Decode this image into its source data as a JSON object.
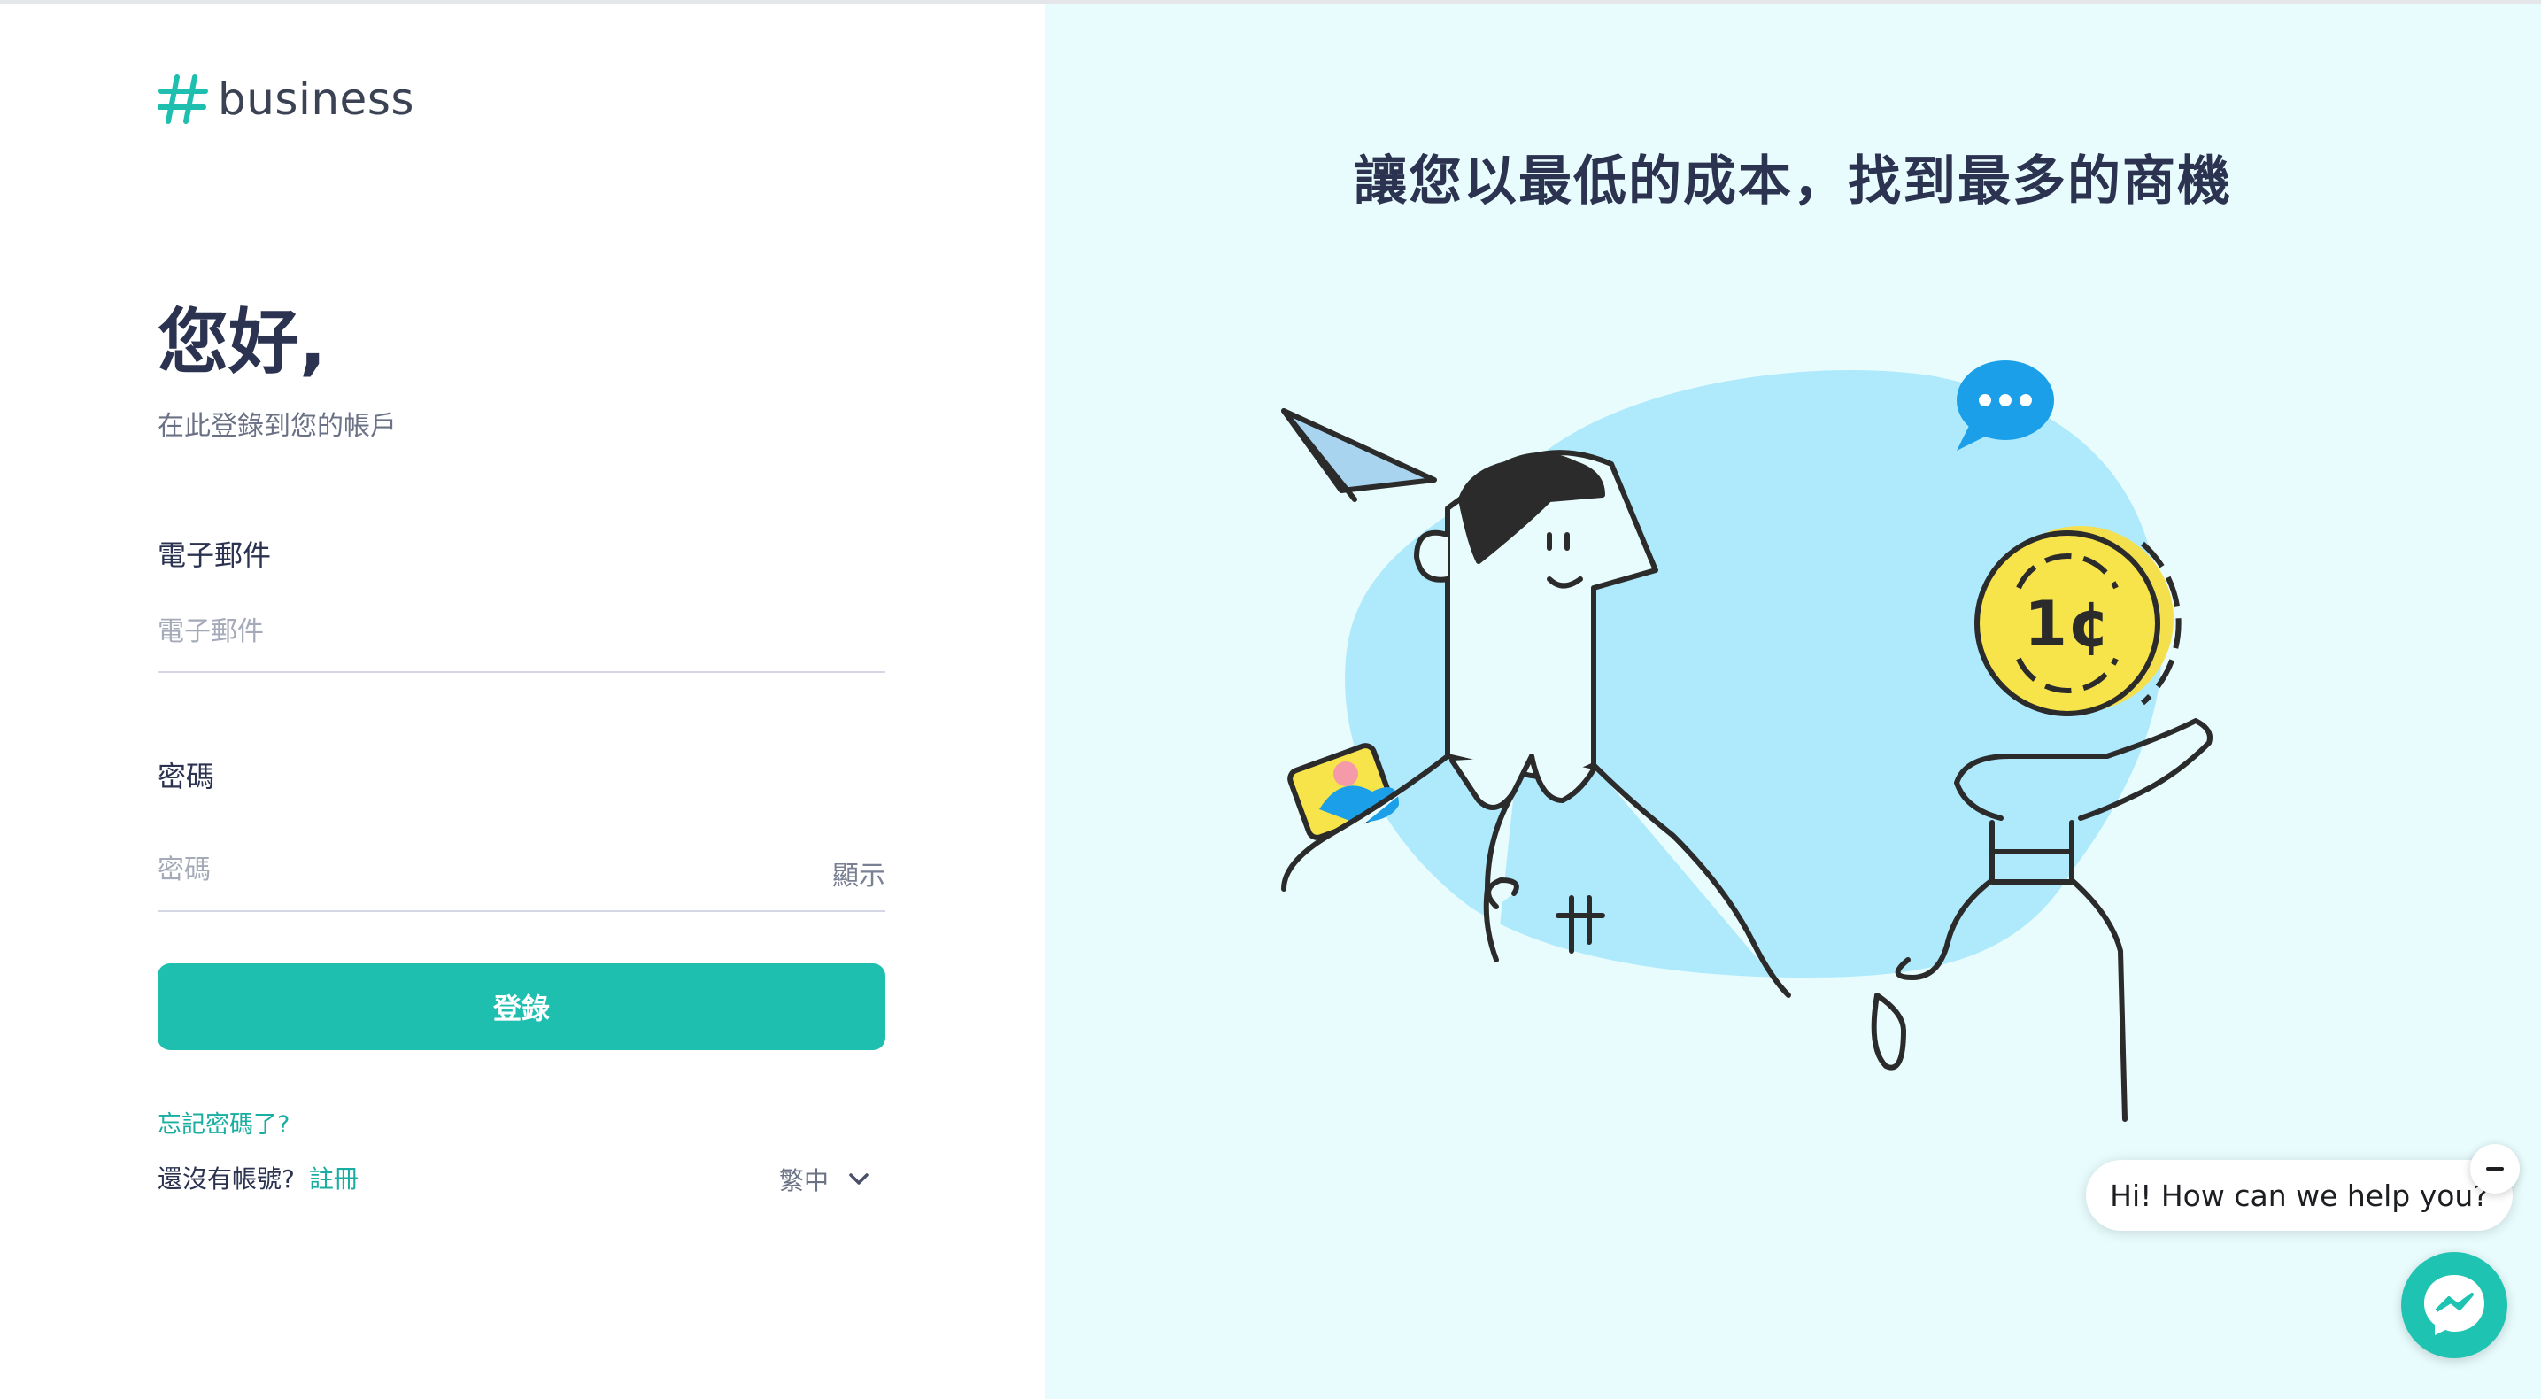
{
  "brand": {
    "logo_text": "business",
    "logo_icon": "hash-icon",
    "accent_color": "#1fbfb0"
  },
  "login": {
    "greeting": "您好,",
    "subtitle": "在此登錄到您的帳戶",
    "email_label": "電子郵件",
    "email_placeholder": "電子郵件",
    "password_label": "密碼",
    "password_placeholder": "密碼",
    "show_password": "顯示",
    "submit_label": "登錄",
    "forgot_link": "忘記密碼了?",
    "no_account_text": "還沒有帳號?",
    "register_link": "註冊",
    "language_selected": "繁中"
  },
  "promo": {
    "headline": "讓您以最低的成本，找到最多的商機",
    "illustration_coin_text": "1¢"
  },
  "chat_widget": {
    "greeting": "Hi! How can we help you?",
    "launcher_icon": "messenger-icon",
    "close_icon": "minus-icon"
  }
}
